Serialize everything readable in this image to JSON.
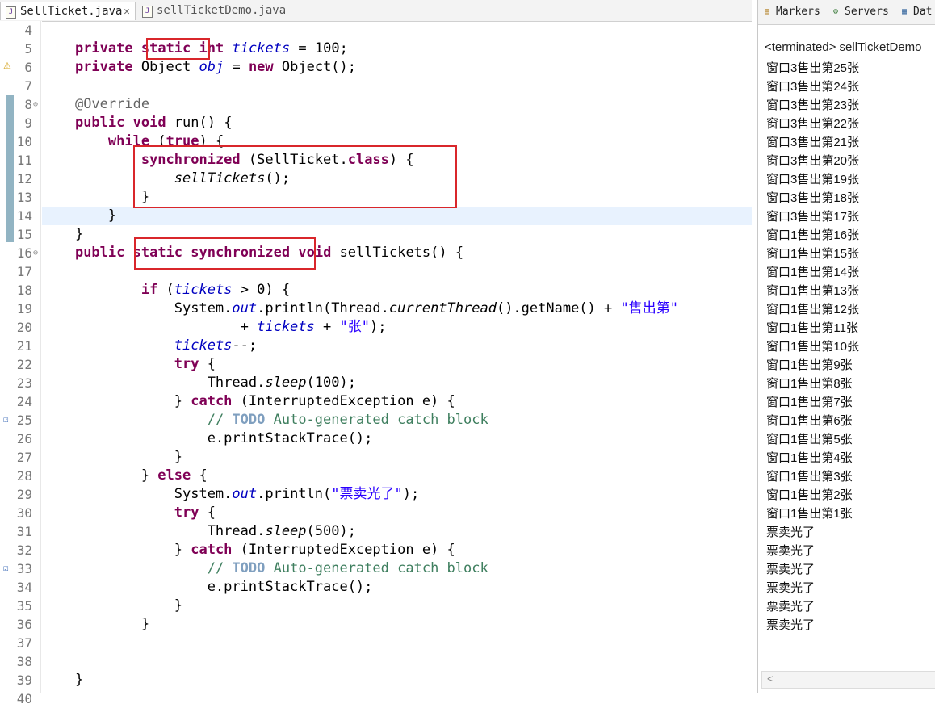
{
  "editor": {
    "tabs": [
      {
        "label": "SellTicket.java",
        "close": "✕",
        "icon": "java-file-icon"
      },
      {
        "label": "sellTicketDemo.java",
        "icon": "java-file-icon"
      }
    ],
    "lines": [
      {
        "n": "4",
        "html": ""
      },
      {
        "n": "5",
        "html": "    <span class='kw'>private</span> <span class='kw'>static</span> <span class='kw'>int</span> <span class='fld'>tickets</span> = 100;"
      },
      {
        "n": "6",
        "html": "    <span class='kw'>private</span> Object <span class='fld'>obj</span> = <span class='kw'>new</span> Object();"
      },
      {
        "n": "7",
        "html": ""
      },
      {
        "n": "8",
        "html": "    <span class='ann'>@Override</span>",
        "fold": "⊖"
      },
      {
        "n": "9",
        "html": "    <span class='kw'>public</span> <span class='kw'>void</span> run() {"
      },
      {
        "n": "10",
        "html": "        <span class='kw'>while</span> (<span class='kw'>true</span>) {"
      },
      {
        "n": "11",
        "html": "            <span class='kw'>synchronized</span> (SellTicket.<span class='kw'>class</span>) {"
      },
      {
        "n": "12",
        "html": "                <span class='it'>sellTickets</span>();"
      },
      {
        "n": "13",
        "html": "            }"
      },
      {
        "n": "14",
        "html": "        }",
        "current": true
      },
      {
        "n": "15",
        "html": "    }"
      },
      {
        "n": "16",
        "html": "    <span class='kw'>public</span> <span class='kw'>static</span> <span class='kw'>synchronized</span> <span class='kw'>void</span> sellTickets() {",
        "fold": "⊖"
      },
      {
        "n": "17",
        "html": ""
      },
      {
        "n": "18",
        "html": "            <span class='kw'>if</span> (<span class='fld'>tickets</span> &gt; 0) {"
      },
      {
        "n": "19",
        "html": "                System.<span class='fld'>out</span>.println(Thread.<span class='it'>currentThread</span>().getName() + <span class='str'>\"售出第\"</span>"
      },
      {
        "n": "20",
        "html": "                        + <span class='fld'>tickets</span> + <span class='str'>\"张\"</span>);"
      },
      {
        "n": "21",
        "html": "                <span class='fld'>tickets</span>--;"
      },
      {
        "n": "22",
        "html": "                <span class='kw'>try</span> {"
      },
      {
        "n": "23",
        "html": "                    Thread.<span class='it'>sleep</span>(100);"
      },
      {
        "n": "24",
        "html": "                } <span class='kw'>catch</span> (InterruptedException e) {"
      },
      {
        "n": "25",
        "html": "                    <span class='cm'>// </span><span class='todo'>TODO</span><span class='cm'> Auto-generated catch block</span>",
        "mark": true
      },
      {
        "n": "26",
        "html": "                    e.printStackTrace();"
      },
      {
        "n": "27",
        "html": "                }"
      },
      {
        "n": "28",
        "html": "            } <span class='kw'>else</span> {"
      },
      {
        "n": "29",
        "html": "                System.<span class='fld'>out</span>.println(<span class='str'>\"票卖光了\"</span>);"
      },
      {
        "n": "30",
        "html": "                <span class='kw'>try</span> {"
      },
      {
        "n": "31",
        "html": "                    Thread.<span class='it'>sleep</span>(500);"
      },
      {
        "n": "32",
        "html": "                } <span class='kw'>catch</span> (InterruptedException e) {"
      },
      {
        "n": "33",
        "html": "                    <span class='cm'>// </span><span class='todo'>TODO</span><span class='cm'> Auto-generated catch block</span>",
        "mark": true
      },
      {
        "n": "34",
        "html": "                    e.printStackTrace();"
      },
      {
        "n": "35",
        "html": "                }"
      },
      {
        "n": "36",
        "html": "            }"
      },
      {
        "n": "37",
        "html": ""
      },
      {
        "n": "38",
        "html": ""
      },
      {
        "n": "39",
        "html": "    }"
      },
      {
        "n": "40",
        "html": ""
      }
    ]
  },
  "console": {
    "tabs": [
      {
        "label": "Markers",
        "icon": "markers-icon"
      },
      {
        "label": "Servers",
        "icon": "servers-icon"
      },
      {
        "label": "Dat",
        "icon": "data-source-icon"
      }
    ],
    "terminated": "<terminated> sellTicketDemo",
    "output": [
      "窗口3售出第25张",
      "窗口3售出第24张",
      "窗口3售出第23张",
      "窗口3售出第22张",
      "窗口3售出第21张",
      "窗口3售出第20张",
      "窗口3售出第19张",
      "窗口3售出第18张",
      "窗口3售出第17张",
      "窗口1售出第16张",
      "窗口1售出第15张",
      "窗口1售出第14张",
      "窗口1售出第13张",
      "窗口1售出第12张",
      "窗口1售出第11张",
      "窗口1售出第10张",
      "窗口1售出第9张",
      "窗口1售出第8张",
      "窗口1售出第7张",
      "窗口1售出第6张",
      "窗口1售出第5张",
      "窗口1售出第4张",
      "窗口1售出第3张",
      "窗口1售出第2张",
      "窗口1售出第1张",
      "票卖光了",
      "票卖光了",
      "票卖光了",
      "票卖光了",
      "票卖光了",
      "票卖光了"
    ],
    "scroll_left": "<"
  },
  "colors": {
    "highlight_box": "#d9262b",
    "keyword": "#7f0055",
    "field": "#0000c0",
    "string": "#2a00ff",
    "comment": "#3f7f5f"
  }
}
